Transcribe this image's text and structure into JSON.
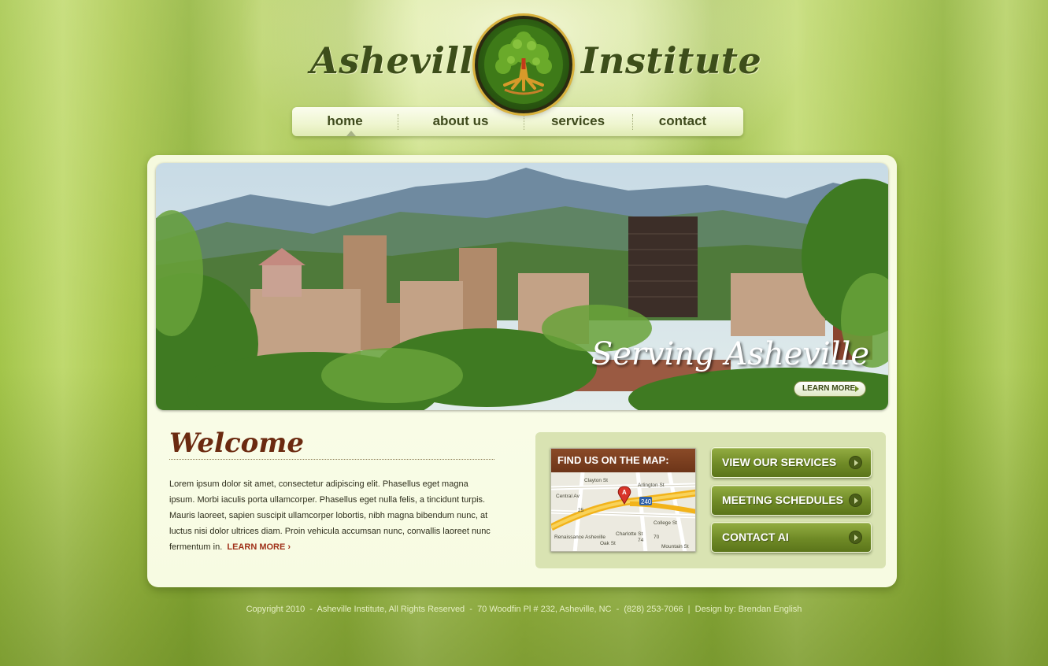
{
  "header": {
    "logo_left": "Asheville",
    "logo_right": "Institute",
    "emblem_icon": "tree-of-life-icon"
  },
  "nav": {
    "items": [
      {
        "label": "home",
        "active": true
      },
      {
        "label": "about us"
      },
      {
        "label": "services"
      },
      {
        "label": "contact"
      }
    ]
  },
  "banner": {
    "title": "Serving Asheville",
    "button_label": "LEARN MORE"
  },
  "welcome": {
    "title": "Welcome",
    "body": "Lorem ipsum dolor sit amet, consectetur adipiscing elit. Phasellus eget magna ipsum. Morbi iaculis porta ullamcorper. Phasellus eget nulla felis, a tincidunt turpis. Mauris laoreet, sapien suscipit ullamcorper lobortis, nibh magna bibendum nunc, at luctus nisi dolor ultrices diam. Proin vehicula accumsan nunc, convallis laoreet nunc fermentum in.",
    "learn_more": "LEARN MORE",
    "learn_more_arrow": "›"
  },
  "map": {
    "header": "FIND US ON THE MAP:",
    "labels": [
      "Clayton St",
      "Arlington St",
      "Central Av",
      "240",
      "College St",
      "Charlotte St",
      "Renaissance Asheville",
      "74",
      "70",
      "Mountain St",
      "Oak St",
      "College St",
      "25",
      "A"
    ]
  },
  "buttons": [
    {
      "label": "VIEW OUR SERVICES"
    },
    {
      "label": "MEETING SCHEDULES"
    },
    {
      "label": "CONTACT AI"
    }
  ],
  "footer": {
    "text": "Copyright 2010  -  Asheville Institute, All Rights Reserved  -  70 Woodfin Pl # 232, Asheville, NC  -  (828) 253-7066  |  Design by: Brendan English"
  },
  "colors": {
    "brand_green": "#6f8a26",
    "brand_brown": "#6b2a10",
    "link_red": "#a0321a"
  }
}
